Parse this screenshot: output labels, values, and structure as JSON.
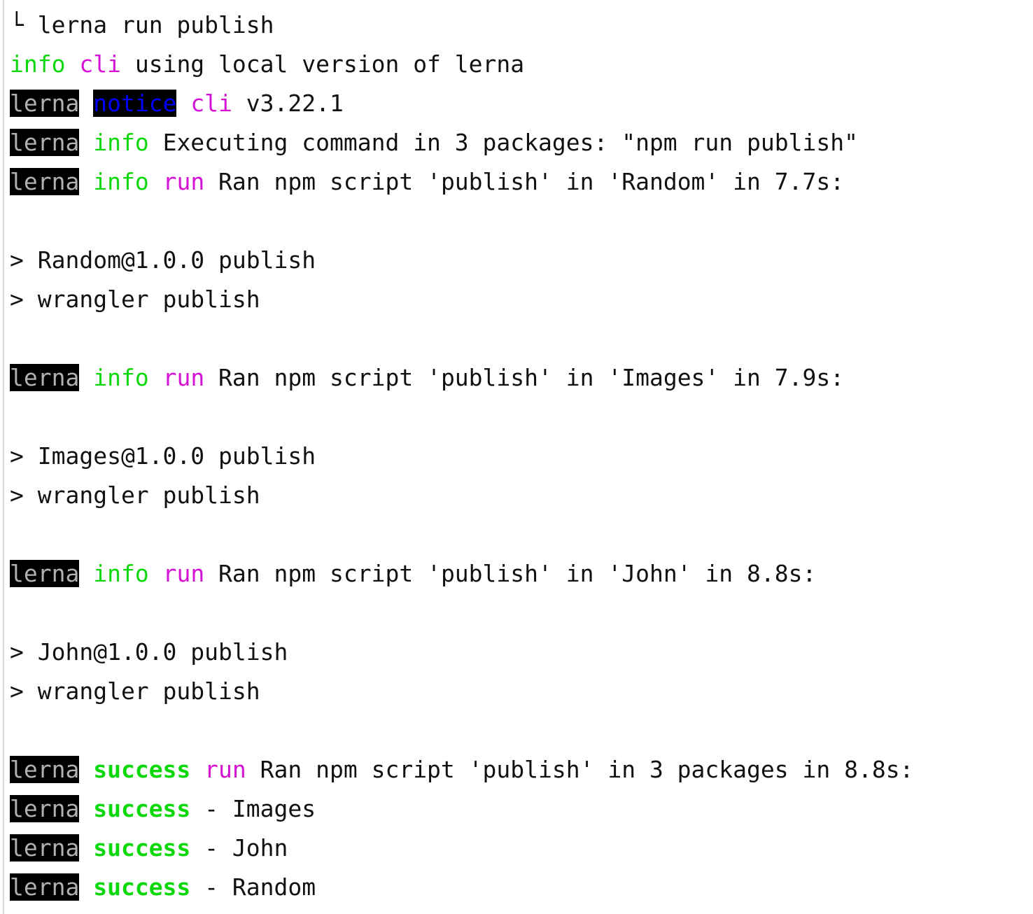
{
  "terminal": {
    "title": "lerna run publish",
    "background_color": "#ffffff",
    "foreground_color": "#111111",
    "left_rule_color": "#d8d8d8",
    "colors": {
      "green": "#0bd80b",
      "magenta": "#d413d4",
      "blue": "#0000ff",
      "badge_bg": "#000000",
      "badge_fg": "#b0b0b0"
    },
    "prompt_glyph": "└",
    "command": "lerna run publish",
    "lines": [
      {
        "id": "line-command",
        "tokens": [
          {
            "text": "└ ",
            "style": "plain"
          },
          {
            "text": "lerna run publish",
            "style": "plain"
          }
        ]
      },
      {
        "id": "line-cli-local-version",
        "tokens": [
          {
            "text": "info",
            "style": "green"
          },
          {
            "text": " ",
            "style": "plain"
          },
          {
            "text": "cli",
            "style": "magenta"
          },
          {
            "text": " using local version of lerna",
            "style": "plain"
          }
        ]
      },
      {
        "id": "line-notice-cli-version",
        "tokens": [
          {
            "text": "lerna",
            "style": "badge-lerna"
          },
          {
            "text": " ",
            "style": "plain"
          },
          {
            "text": "notice",
            "style": "badge-notice"
          },
          {
            "text": " ",
            "style": "plain"
          },
          {
            "text": "cli",
            "style": "magenta"
          },
          {
            "text": " v3.22.1",
            "style": "plain"
          }
        ]
      },
      {
        "id": "line-executing-command",
        "tokens": [
          {
            "text": "lerna",
            "style": "badge-lerna"
          },
          {
            "text": " ",
            "style": "plain"
          },
          {
            "text": "info",
            "style": "green"
          },
          {
            "text": " Executing command in 3 packages: \"npm run publish\"",
            "style": "plain"
          }
        ]
      },
      {
        "id": "line-ran-random",
        "tokens": [
          {
            "text": "lerna",
            "style": "badge-lerna"
          },
          {
            "text": " ",
            "style": "plain"
          },
          {
            "text": "info",
            "style": "green"
          },
          {
            "text": " ",
            "style": "plain"
          },
          {
            "text": "run",
            "style": "magenta"
          },
          {
            "text": " Ran npm script 'publish' in 'Random' in 7.7s:",
            "style": "plain"
          }
        ]
      },
      {
        "id": "line-blank-1",
        "tokens": [
          {
            "text": " ",
            "style": "plain"
          }
        ]
      },
      {
        "id": "line-random-pkg",
        "tokens": [
          {
            "text": "> Random@1.0.0 publish",
            "style": "plain"
          }
        ]
      },
      {
        "id": "line-random-wrangler",
        "tokens": [
          {
            "text": "> wrangler publish",
            "style": "plain"
          }
        ]
      },
      {
        "id": "line-blank-2",
        "tokens": [
          {
            "text": " ",
            "style": "plain"
          }
        ]
      },
      {
        "id": "line-ran-images",
        "tokens": [
          {
            "text": "lerna",
            "style": "badge-lerna"
          },
          {
            "text": " ",
            "style": "plain"
          },
          {
            "text": "info",
            "style": "green"
          },
          {
            "text": " ",
            "style": "plain"
          },
          {
            "text": "run",
            "style": "magenta"
          },
          {
            "text": " Ran npm script 'publish' in 'Images' in 7.9s:",
            "style": "plain"
          }
        ]
      },
      {
        "id": "line-blank-3",
        "tokens": [
          {
            "text": " ",
            "style": "plain"
          }
        ]
      },
      {
        "id": "line-images-pkg",
        "tokens": [
          {
            "text": "> Images@1.0.0 publish",
            "style": "plain"
          }
        ]
      },
      {
        "id": "line-images-wrangler",
        "tokens": [
          {
            "text": "> wrangler publish",
            "style": "plain"
          }
        ]
      },
      {
        "id": "line-blank-4",
        "tokens": [
          {
            "text": " ",
            "style": "plain"
          }
        ]
      },
      {
        "id": "line-ran-john",
        "tokens": [
          {
            "text": "lerna",
            "style": "badge-lerna"
          },
          {
            "text": " ",
            "style": "plain"
          },
          {
            "text": "info",
            "style": "green"
          },
          {
            "text": " ",
            "style": "plain"
          },
          {
            "text": "run",
            "style": "magenta"
          },
          {
            "text": " Ran npm script 'publish' in 'John' in 8.8s:",
            "style": "plain"
          }
        ]
      },
      {
        "id": "line-blank-5",
        "tokens": [
          {
            "text": " ",
            "style": "plain"
          }
        ]
      },
      {
        "id": "line-john-pkg",
        "tokens": [
          {
            "text": "> John@1.0.0 publish",
            "style": "plain"
          }
        ]
      },
      {
        "id": "line-john-wrangler",
        "tokens": [
          {
            "text": "> wrangler publish",
            "style": "plain"
          }
        ]
      },
      {
        "id": "line-blank-6",
        "tokens": [
          {
            "text": " ",
            "style": "plain"
          }
        ]
      },
      {
        "id": "line-success-summary",
        "tokens": [
          {
            "text": "lerna",
            "style": "badge-lerna"
          },
          {
            "text": " ",
            "style": "plain"
          },
          {
            "text": "success",
            "style": "green-bold"
          },
          {
            "text": " ",
            "style": "plain"
          },
          {
            "text": "run",
            "style": "magenta"
          },
          {
            "text": " Ran npm script 'publish' in 3 packages in 8.8s:",
            "style": "plain"
          }
        ]
      },
      {
        "id": "line-success-images",
        "tokens": [
          {
            "text": "lerna",
            "style": "badge-lerna"
          },
          {
            "text": " ",
            "style": "plain"
          },
          {
            "text": "success",
            "style": "green-bold"
          },
          {
            "text": " - Images",
            "style": "plain"
          }
        ]
      },
      {
        "id": "line-success-john",
        "tokens": [
          {
            "text": "lerna",
            "style": "badge-lerna"
          },
          {
            "text": " ",
            "style": "plain"
          },
          {
            "text": "success",
            "style": "green-bold"
          },
          {
            "text": " - John",
            "style": "plain"
          }
        ]
      },
      {
        "id": "line-success-random",
        "tokens": [
          {
            "text": "lerna",
            "style": "badge-lerna"
          },
          {
            "text": " ",
            "style": "plain"
          },
          {
            "text": "success",
            "style": "green-bold"
          },
          {
            "text": " - Random",
            "style": "plain"
          }
        ]
      }
    ]
  }
}
